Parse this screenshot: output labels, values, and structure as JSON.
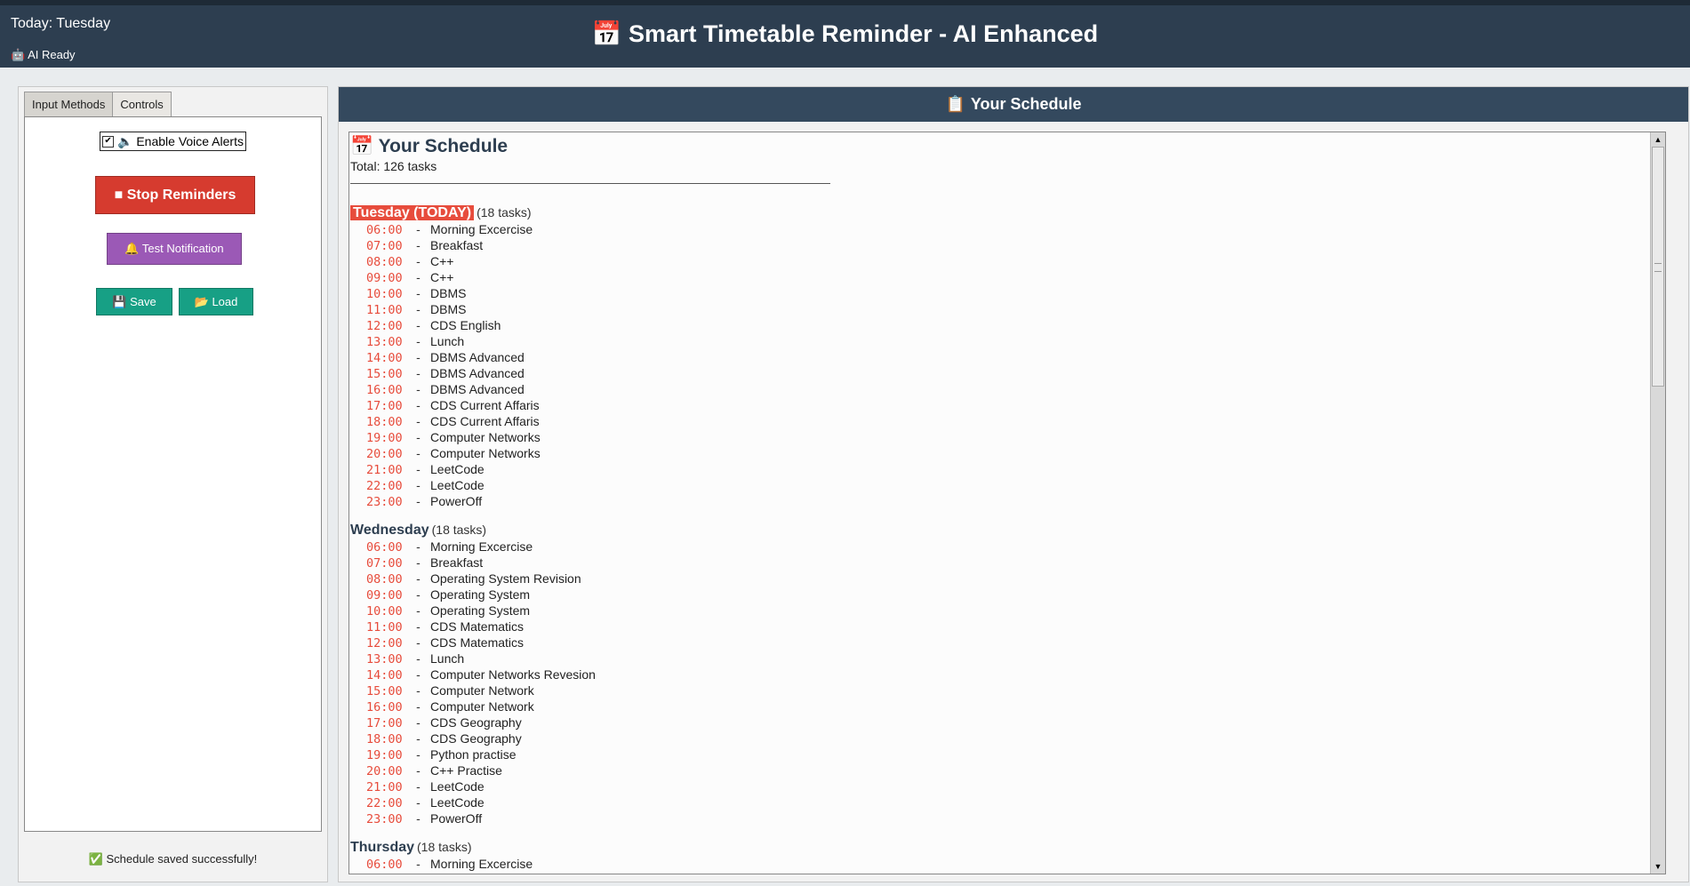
{
  "header": {
    "today_label": "Today: Tuesday",
    "ai_status": "🤖 AI Ready",
    "title_icon": "📅",
    "title": "Smart Timetable Reminder - AI Enhanced",
    "bg_color": "#2d3e50"
  },
  "left_panel": {
    "tabs": [
      {
        "label": "Input Methods",
        "active": false
      },
      {
        "label": "Controls",
        "active": true
      }
    ],
    "voice_alerts": {
      "label": "🔈 Enable Voice Alerts",
      "checked": true
    },
    "buttons": {
      "stop": "■ Stop Reminders",
      "test": "🔔 Test Notification",
      "save": "💾 Save",
      "load": "📂 Load"
    },
    "status": "✅ Schedule saved successfully!"
  },
  "right_panel": {
    "header_icon": "📋",
    "header": "Your Schedule",
    "title_icon": "📅",
    "title": "Your Schedule",
    "total": "Total: 126 tasks",
    "days": [
      {
        "name": "Tuesday (TODAY)",
        "count": "(18 tasks)",
        "today": true,
        "tasks": [
          {
            "time": "06:00",
            "name": "Morning Excercise"
          },
          {
            "time": "07:00",
            "name": "Breakfast"
          },
          {
            "time": "08:00",
            "name": "C++"
          },
          {
            "time": "09:00",
            "name": "C++"
          },
          {
            "time": "10:00",
            "name": "DBMS"
          },
          {
            "time": "11:00",
            "name": "DBMS"
          },
          {
            "time": "12:00",
            "name": "CDS English"
          },
          {
            "time": "13:00",
            "name": "Lunch"
          },
          {
            "time": "14:00",
            "name": "DBMS Advanced"
          },
          {
            "time": "15:00",
            "name": "DBMS Advanced"
          },
          {
            "time": "16:00",
            "name": "DBMS Advanced"
          },
          {
            "time": "17:00",
            "name": "CDS Current Affaris"
          },
          {
            "time": "18:00",
            "name": "CDS Current Affaris"
          },
          {
            "time": "19:00",
            "name": "Computer Networks"
          },
          {
            "time": "20:00",
            "name": "Computer Networks"
          },
          {
            "time": "21:00",
            "name": "LeetCode"
          },
          {
            "time": "22:00",
            "name": "LeetCode"
          },
          {
            "time": "23:00",
            "name": "PowerOff"
          }
        ]
      },
      {
        "name": "Wednesday",
        "count": "(18 tasks)",
        "today": false,
        "tasks": [
          {
            "time": "06:00",
            "name": "Morning Excercise"
          },
          {
            "time": "07:00",
            "name": "Breakfast"
          },
          {
            "time": "08:00",
            "name": "Operating System Revision"
          },
          {
            "time": "09:00",
            "name": "Operating System"
          },
          {
            "time": "10:00",
            "name": "Operating System"
          },
          {
            "time": "11:00",
            "name": "CDS Matematics"
          },
          {
            "time": "12:00",
            "name": "CDS Matematics"
          },
          {
            "time": "13:00",
            "name": "Lunch"
          },
          {
            "time": "14:00",
            "name": "Computer Networks Revesion"
          },
          {
            "time": "15:00",
            "name": "Computer Network"
          },
          {
            "time": "16:00",
            "name": "Computer Network"
          },
          {
            "time": "17:00",
            "name": "CDS Geography"
          },
          {
            "time": "18:00",
            "name": "CDS Geography"
          },
          {
            "time": "19:00",
            "name": "Python practise"
          },
          {
            "time": "20:00",
            "name": "C++ Practise"
          },
          {
            "time": "21:00",
            "name": "LeetCode"
          },
          {
            "time": "22:00",
            "name": "LeetCode"
          },
          {
            "time": "23:00",
            "name": "PowerOff"
          }
        ]
      },
      {
        "name": "Thursday",
        "count": "(18 tasks)",
        "today": false,
        "tasks": [
          {
            "time": "06:00",
            "name": "Morning Excercise"
          }
        ]
      }
    ]
  }
}
